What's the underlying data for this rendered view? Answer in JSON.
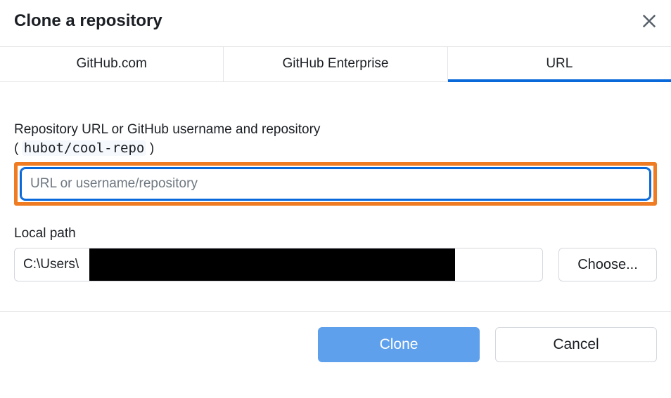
{
  "header": {
    "title": "Clone a repository"
  },
  "tabs": [
    {
      "label": "GitHub.com",
      "active": false
    },
    {
      "label": "GitHub Enterprise",
      "active": false
    },
    {
      "label": "URL",
      "active": true
    }
  ],
  "url_field": {
    "label": "Repository URL or GitHub username and repository",
    "hint_open": "(",
    "hint_mono": "hubot/cool-repo",
    "hint_close": ")",
    "placeholder": "URL or username/repository",
    "value": ""
  },
  "localpath": {
    "label": "Local path",
    "value": "C:\\Users\\",
    "choose_label": "Choose..."
  },
  "actions": {
    "primary": "Clone",
    "secondary": "Cancel"
  }
}
